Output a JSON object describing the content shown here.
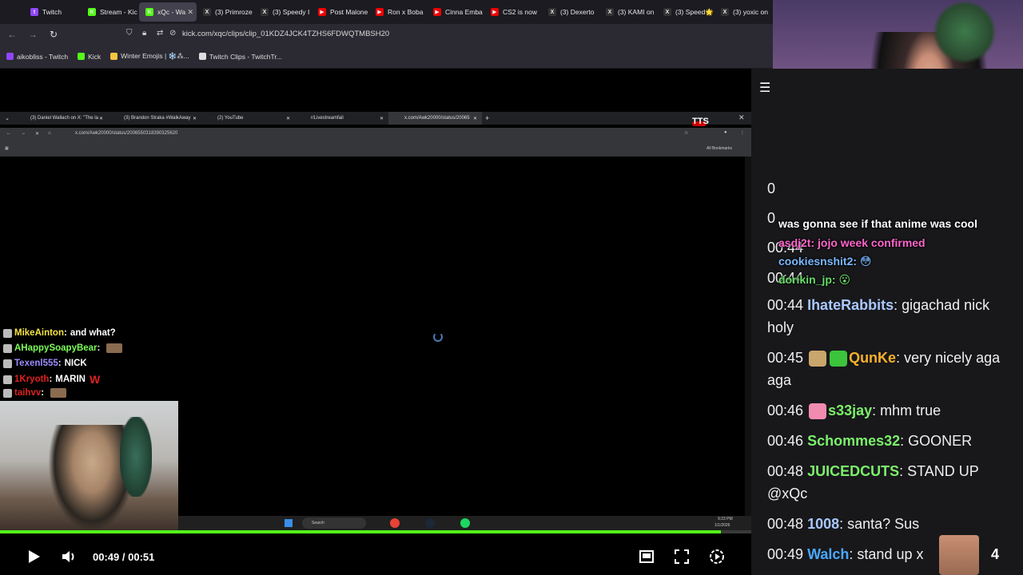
{
  "browser": {
    "tabs": [
      {
        "label": "Twitch",
        "color": "#9146ff",
        "glyph": "t"
      },
      {
        "label": "Stream - Kic",
        "color": "#53fc18",
        "glyph": "K"
      },
      {
        "label": "xQc - Wa",
        "color": "#53fc18",
        "glyph": "K",
        "active": true
      },
      {
        "label": "(3) Primroze",
        "color": "#333",
        "glyph": "X"
      },
      {
        "label": "(3) Speedy I",
        "color": "#333",
        "glyph": "X"
      },
      {
        "label": "Post Malone",
        "color": "#e00",
        "glyph": "▶"
      },
      {
        "label": "Ron x Boba",
        "color": "#e00",
        "glyph": "▶"
      },
      {
        "label": "Cinna Emba",
        "color": "#e00",
        "glyph": "▶"
      },
      {
        "label": "CS2 is now",
        "color": "#e00",
        "glyph": "▶"
      },
      {
        "label": "(3) Dexerto",
        "color": "#333",
        "glyph": "X"
      },
      {
        "label": "(3) KAMI on",
        "color": "#333",
        "glyph": "X"
      },
      {
        "label": "(3) Speed🌟",
        "color": "#333",
        "glyph": "X"
      },
      {
        "label": "(3) yoxic on",
        "color": "#333",
        "glyph": "X"
      }
    ],
    "url": "kick.com/xqc/clips/clip_01KDZ4JCK4TZHS6FDWQTMBSH20",
    "bookmarks": [
      {
        "label": "aikobliss - Twitch",
        "color": "#9146ff"
      },
      {
        "label": "Kick",
        "color": "#53fc18"
      },
      {
        "label": "Winter Emojis | ❄️⁂...",
        "color": "#f5c542"
      },
      {
        "label": "Twitch Clips - TwitchTr...",
        "color": "#ddd"
      }
    ]
  },
  "inner_browser": {
    "tabs": [
      {
        "label": "(3) Daniel Wallach on X: \"The la",
        "active": false
      },
      {
        "label": "(3) Brandon Straka #WalkAway",
        "active": false
      },
      {
        "label": "(2) YouTube",
        "active": false
      },
      {
        "label": "r/Livestreamfail",
        "active": false
      },
      {
        "label": "x.com/Awk20000/status/20065",
        "active": true
      }
    ],
    "url": "x.com/Awk20000/status/2006550318390325620",
    "bookmarks_label": "All Bookmarks",
    "tts_label": "TTS",
    "taskbar_search": "Search",
    "taskbar_time": "9:23 PM",
    "taskbar_date": "1/1/2026"
  },
  "overlay_chat": [
    {
      "user": "MikeAinton",
      "color": "#f5e342",
      "text": "and what?"
    },
    {
      "user": "AHappySoapyBear",
      "color": "#7cfc5a",
      "text": ""
    },
    {
      "user": "Texenl555",
      "color": "#9b8cff",
      "text": "NICK"
    },
    {
      "user": "1Kryoth",
      "color": "#e02020",
      "text": "MARIN",
      "suffix": "W"
    },
    {
      "user": "taihvv",
      "color": "#e02020",
      "text": ""
    }
  ],
  "player": {
    "current_time": "00:49",
    "separator": "/",
    "duration": "00:51",
    "progress_fraction": 0.96
  },
  "stream_overlay": [
    {
      "text": "was gonna see if that anime was cool",
      "color": "#ffffff"
    },
    {
      "text": "asdj2t: jojo week confirmed",
      "color": "#ff66cc"
    },
    {
      "text": "cookiesnshit2: 😳",
      "color": "#7ab8ff"
    },
    {
      "text": "dorikin_jp: 😮",
      "color": "#66dd66"
    }
  ],
  "chat": [
    {
      "time": "00:44",
      "user": "IhateRabbits",
      "color": "#a9c8ff",
      "text": "gigachad nick holy"
    },
    {
      "time": "00:45",
      "user": "QunKe",
      "color": "#f7b12a",
      "text": "very nicely aga aga",
      "emotes": [
        "#c9a66b",
        "#3cc43c"
      ]
    },
    {
      "time": "00:46",
      "user": "s33jay",
      "color": "#7cf06a",
      "text": "mhm true",
      "emotes": [
        "#f28bb0"
      ]
    },
    {
      "time": "00:46",
      "user": "Schommes32",
      "color": "#7cf06a",
      "text": "GOONER"
    },
    {
      "time": "00:48",
      "user": "JUICEDCUTS",
      "color": "#7cf06a",
      "text": "STAND UP @xQc"
    },
    {
      "time": "00:48",
      "user": "1008",
      "color": "#a9c8ff",
      "text": "santa? Sus"
    },
    {
      "time": "00:49",
      "user": "Walch",
      "color": "#4aa8ff",
      "text": "stand up x"
    }
  ],
  "hidden_chat_times": [
    "0",
    "0",
    "00:44",
    "00:44"
  ],
  "viewer_count": "4"
}
